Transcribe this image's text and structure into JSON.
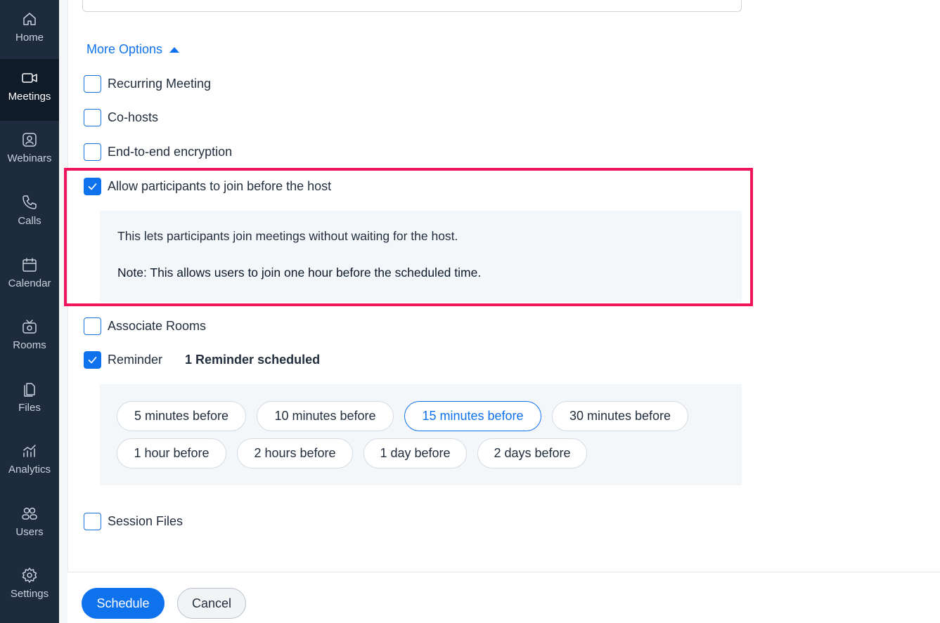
{
  "sidebar": {
    "items": [
      {
        "label": "Home",
        "icon": "home-icon"
      },
      {
        "label": "Meetings",
        "icon": "video-camera-icon",
        "active": true
      },
      {
        "label": "Webinars",
        "icon": "webinar-icon"
      },
      {
        "label": "Calls",
        "icon": "phone-icon"
      },
      {
        "label": "Calendar",
        "icon": "calendar-icon"
      },
      {
        "label": "Rooms",
        "icon": "rooms-icon"
      },
      {
        "label": "Files",
        "icon": "files-icon"
      },
      {
        "label": "Analytics",
        "icon": "analytics-icon"
      },
      {
        "label": "Users",
        "icon": "users-icon"
      },
      {
        "label": "Settings",
        "icon": "gear-icon"
      }
    ]
  },
  "more_options": {
    "label": "More Options"
  },
  "options": {
    "recurring": {
      "label": "Recurring Meeting",
      "checked": false
    },
    "cohosts": {
      "label": "Co-hosts",
      "checked": false
    },
    "e2e": {
      "label": "End-to-end encryption",
      "checked": false
    },
    "join_before_host": {
      "label": "Allow participants to join before the host",
      "checked": true,
      "description": "This lets participants join meetings without waiting for the host.",
      "note": "Note: This allows users to join one hour before the scheduled time."
    },
    "associate_rooms": {
      "label": "Associate Rooms",
      "checked": false
    },
    "reminder": {
      "label": "Reminder",
      "checked": true,
      "summary": "1 Reminder scheduled",
      "chips": [
        {
          "label": "5 minutes before",
          "selected": false
        },
        {
          "label": "10 minutes before",
          "selected": false
        },
        {
          "label": "15 minutes before",
          "selected": true
        },
        {
          "label": "30 minutes before",
          "selected": false
        },
        {
          "label": "1 hour before",
          "selected": false
        },
        {
          "label": "2 hours before",
          "selected": false
        },
        {
          "label": "1 day before",
          "selected": false
        },
        {
          "label": "2 days before",
          "selected": false
        }
      ]
    },
    "session_files": {
      "label": "Session Files",
      "checked": false
    }
  },
  "actions": {
    "schedule": "Schedule",
    "cancel": "Cancel"
  },
  "colors": {
    "accent": "#0e72ed",
    "sidebar": "#1d2b3d",
    "highlight": "#f0145a"
  }
}
